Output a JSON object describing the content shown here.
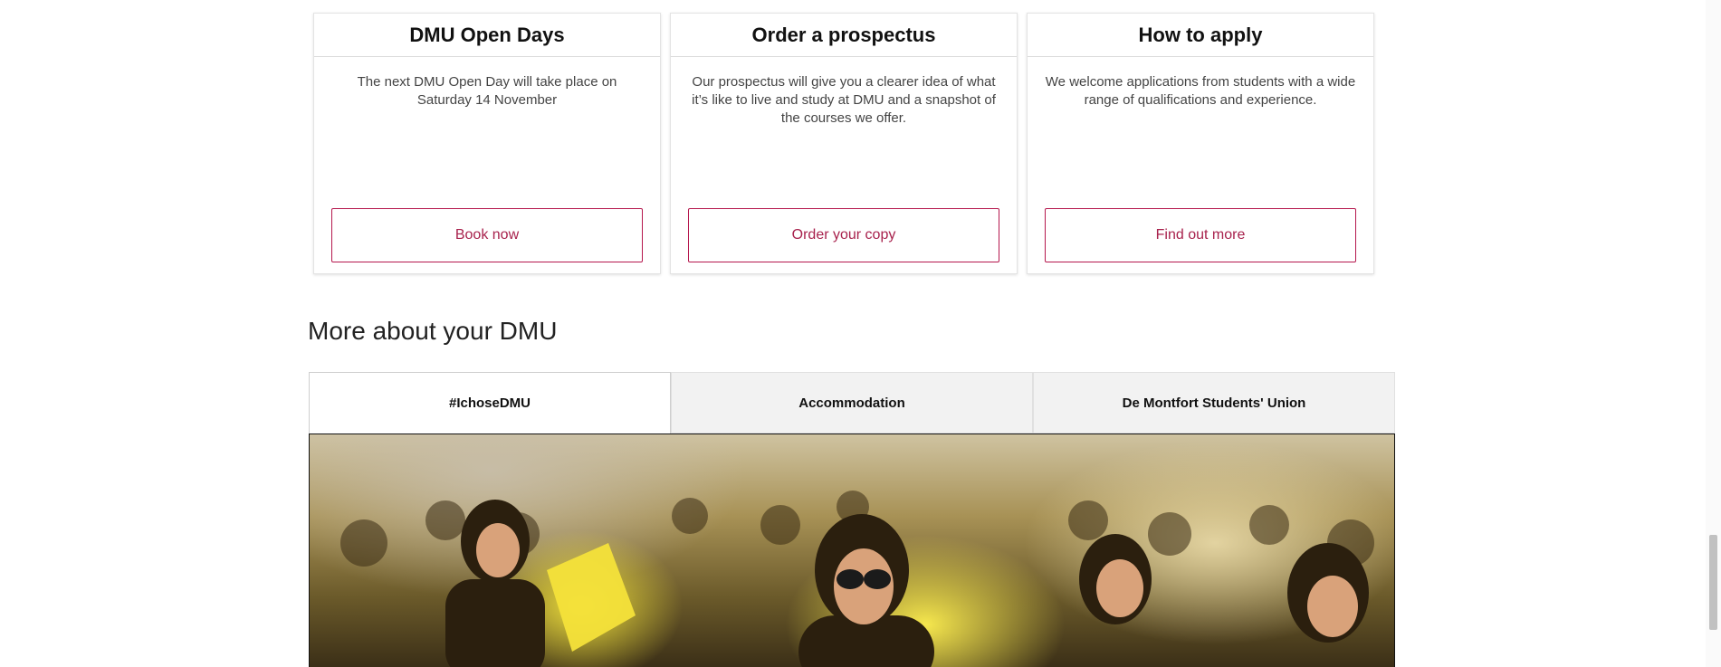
{
  "cards": [
    {
      "title": "DMU Open Days",
      "text": "The next DMU Open Day will take place on Saturday 14 November",
      "button": "Book now"
    },
    {
      "title": "Order a prospectus",
      "text": "Our prospectus will give you a clearer idea of what it’s like to live and study at DMU and a snapshot of the courses we offer.",
      "button": "Order your copy"
    },
    {
      "title": "How to apply",
      "text": "We welcome applications from students with a wide range of qualifications and experience.",
      "button": "Find out more"
    }
  ],
  "more": {
    "heading": "More about your DMU",
    "tabs": [
      {
        "label": "#IchoseDMU",
        "active": true
      },
      {
        "label": "Accommodation",
        "active": false
      },
      {
        "label": "De Montfort Students' Union",
        "active": false
      }
    ]
  },
  "colors": {
    "accent": "#a8224d",
    "tab_inactive_bg": "#f2f2f2"
  }
}
